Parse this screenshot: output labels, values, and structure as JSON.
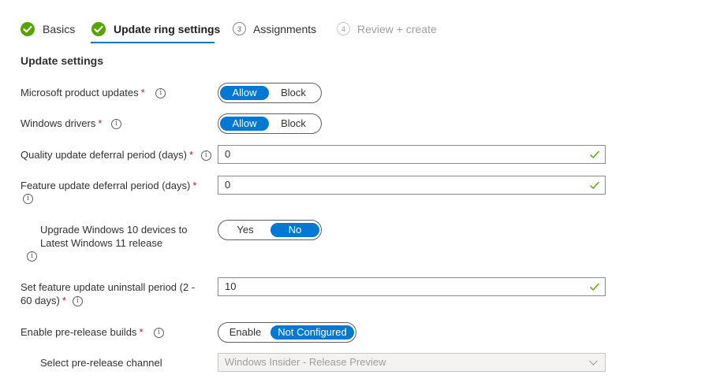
{
  "wizard": {
    "steps": [
      {
        "label": "Basics",
        "state": "complete"
      },
      {
        "label": "Update ring settings",
        "state": "active"
      },
      {
        "label": "Assignments",
        "number": "3",
        "state": "pending"
      },
      {
        "label": "Review + create",
        "number": "4",
        "state": "disabled"
      }
    ]
  },
  "section": {
    "title": "Update settings"
  },
  "settings": {
    "microsoft_product_updates": {
      "label": "Microsoft product updates",
      "required": "*",
      "options": [
        "Allow",
        "Block"
      ],
      "selected": "Allow"
    },
    "windows_drivers": {
      "label": "Windows drivers",
      "required": "*",
      "options": [
        "Allow",
        "Block"
      ],
      "selected": "Allow"
    },
    "quality_deferral": {
      "label": "Quality update deferral period (days)",
      "required": "*",
      "value": "0"
    },
    "feature_deferral": {
      "label": "Feature update deferral period (days)",
      "required": "*",
      "value": "0"
    },
    "upgrade_win11": {
      "label_line1": "Upgrade Windows 10 devices to",
      "label_line2": "Latest Windows 11 release",
      "options": [
        "Yes",
        "No"
      ],
      "selected": "No"
    },
    "uninstall_period": {
      "label_line1": "Set feature update uninstall period (2 -",
      "label_line2": "60 days)",
      "required": "*",
      "value": "10"
    },
    "prerelease_builds": {
      "label": "Enable pre-release builds",
      "required": "*",
      "options": [
        "Enable",
        "Not Configured"
      ],
      "selected": "Not Configured"
    },
    "prerelease_channel": {
      "label": "Select pre-release channel",
      "value": "Windows Insider - Release Preview"
    }
  },
  "colors": {
    "accent": "#0078d4",
    "success": "#57a300",
    "required": "#a4262c",
    "valid_check": "#57a300"
  },
  "icons": {
    "complete": "check-circle-icon",
    "info": "info-icon",
    "valid": "checkmark-icon",
    "dropdown": "chevron-down-icon"
  }
}
